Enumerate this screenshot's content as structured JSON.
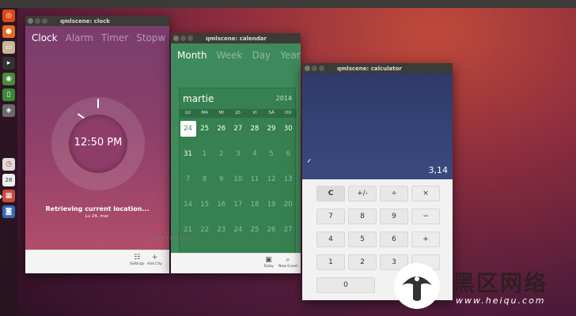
{
  "launcher": {
    "icons": [
      "ubuntu-icon",
      "firefox-icon",
      "files-icon",
      "terminal-icon",
      "eye-icon",
      "phone-icon",
      "photos-icon",
      "clock-icon",
      "calendar-icon",
      "settings-icon",
      "dash-icon"
    ],
    "calendar_badge": "28"
  },
  "clock_window": {
    "title": "qmlscene: clock",
    "tabs": [
      "Clock",
      "Alarm",
      "Timer",
      "Stopw"
    ],
    "time": "12:50 PM",
    "status": "Retrieving current location...",
    "date": "Lu 24, mar.",
    "actions": [
      {
        "icon": "settings-icon",
        "label": "Settings"
      },
      {
        "icon": "add-icon",
        "label": "Add City"
      }
    ],
    "watermark": "SOFTPEDIA"
  },
  "calendar_window": {
    "title": "qmlscene: calendar",
    "tabs": [
      "Month",
      "Week",
      "Day",
      "Year"
    ],
    "month": "martie",
    "year": "2014",
    "weekdays": [
      "LU",
      "MA",
      "MI",
      "JO",
      "VI",
      "SÂ",
      "DU"
    ],
    "weeks": [
      [
        {
          "d": "24",
          "t": "today"
        },
        {
          "d": "25"
        },
        {
          "d": "26"
        },
        {
          "d": "27"
        },
        {
          "d": "28"
        },
        {
          "d": "29"
        },
        {
          "d": "30"
        }
      ],
      [
        {
          "d": "31"
        },
        {
          "d": "1",
          "t": "dim"
        },
        {
          "d": "2",
          "t": "dim"
        },
        {
          "d": "3",
          "t": "dim"
        },
        {
          "d": "4",
          "t": "dim"
        },
        {
          "d": "5",
          "t": "dim"
        },
        {
          "d": "6",
          "t": "dim"
        }
      ],
      [
        {
          "d": "7",
          "t": "dim"
        },
        {
          "d": "8",
          "t": "dim"
        },
        {
          "d": "9",
          "t": "dim"
        },
        {
          "d": "10",
          "t": "dim"
        },
        {
          "d": "11",
          "t": "dim"
        },
        {
          "d": "12",
          "t": "dim"
        },
        {
          "d": "13",
          "t": "dim"
        }
      ],
      [
        {
          "d": "14",
          "t": "dim"
        },
        {
          "d": "15",
          "t": "dim"
        },
        {
          "d": "16",
          "t": "dim"
        },
        {
          "d": "17",
          "t": "dim"
        },
        {
          "d": "18",
          "t": "dim"
        },
        {
          "d": "19",
          "t": "dim"
        },
        {
          "d": "20",
          "t": "dim"
        }
      ],
      [
        {
          "d": "21",
          "t": "dim"
        },
        {
          "d": "22",
          "t": "dim"
        },
        {
          "d": "23",
          "t": "dim"
        },
        {
          "d": "24",
          "t": "dim"
        },
        {
          "d": "25",
          "t": "dim"
        },
        {
          "d": "26",
          "t": "dim"
        },
        {
          "d": "27",
          "t": "dim"
        }
      ]
    ],
    "actions": [
      {
        "icon": "today-icon",
        "label": "Today"
      },
      {
        "icon": "new-event-icon",
        "label": "New Event"
      }
    ]
  },
  "calculator_window": {
    "title": "qmlscene: calculator",
    "result": "3,14",
    "keys": [
      [
        "C",
        "+/-",
        "÷",
        "×"
      ],
      [
        "7",
        "8",
        "9",
        "−"
      ],
      [
        "4",
        "5",
        "6",
        "+"
      ],
      [
        "1",
        "2",
        "3",
        ""
      ],
      [
        "0",
        "",
        "",
        ""
      ]
    ]
  },
  "brand": {
    "chinese": "黑区网络",
    "url": "www.heiqu.com"
  },
  "colors": {
    "clock_bg": "#8b3f6a",
    "calendar_bg": "#3e8a5c",
    "calculator_display": "#35427a",
    "titlebar": "#3c3b37"
  }
}
